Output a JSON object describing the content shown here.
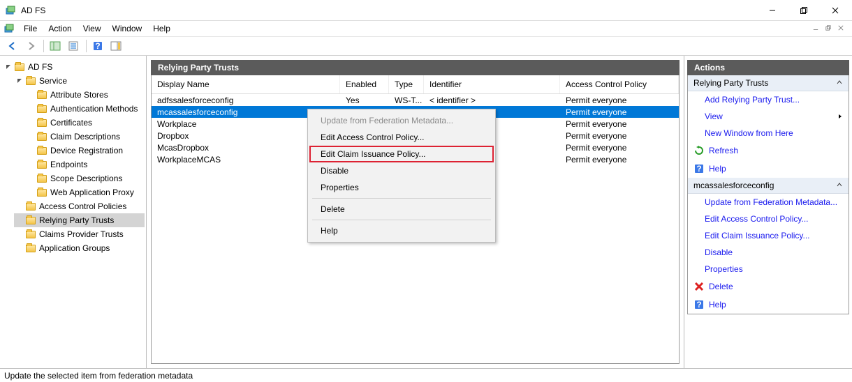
{
  "window": {
    "title": "AD FS"
  },
  "menubar": {
    "items": [
      "File",
      "Action",
      "View",
      "Window",
      "Help"
    ]
  },
  "tree": {
    "root": "AD FS",
    "service": {
      "label": "Service",
      "children": [
        "Attribute Stores",
        "Authentication Methods",
        "Certificates",
        "Claim Descriptions",
        "Device Registration",
        "Endpoints",
        "Scope Descriptions",
        "Web Application Proxy"
      ]
    },
    "siblings": [
      "Access Control Policies",
      "Relying Party Trusts",
      "Claims Provider Trusts",
      "Application Groups"
    ],
    "selected": "Relying Party Trusts"
  },
  "center": {
    "title": "Relying Party Trusts",
    "columns": [
      "Display Name",
      "Enabled",
      "Type",
      "Identifier",
      "Access Control Policy"
    ],
    "rows": [
      {
        "name": "adfssalesforceconfig",
        "enabled": "Yes",
        "type": "WS-T...",
        "identifier": "< identifier >",
        "acp": "Permit everyone",
        "sel": false
      },
      {
        "name": "mcassalesforceconfig",
        "enabled": "",
        "type": "",
        "identifier": "",
        "acp": "Permit everyone",
        "sel": true
      },
      {
        "name": "Workplace",
        "enabled": "",
        "type": "",
        "identifier": "",
        "acp": "Permit everyone",
        "sel": false
      },
      {
        "name": "Dropbox",
        "enabled": "",
        "type": "",
        "identifier": "",
        "acp": "Permit everyone",
        "sel": false
      },
      {
        "name": "McasDropbox",
        "enabled": "",
        "type": "",
        "identifier": "",
        "acp": "Permit everyone",
        "sel": false
      },
      {
        "name": "WorkplaceMCAS",
        "enabled": "",
        "type": "",
        "identifier": "",
        "acp": "Permit everyone",
        "sel": false
      }
    ]
  },
  "context": {
    "items": [
      {
        "label": "Update from Federation Metadata...",
        "state": "disabled"
      },
      {
        "label": "Edit Access Control Policy...",
        "state": ""
      },
      {
        "label": "Edit Claim Issuance Policy...",
        "state": "highlighted"
      },
      {
        "label": "Disable",
        "state": ""
      },
      {
        "label": "Properties",
        "state": ""
      },
      {
        "sep": true
      },
      {
        "label": "Delete",
        "state": ""
      },
      {
        "sep": true
      },
      {
        "label": "Help",
        "state": ""
      }
    ]
  },
  "actions": {
    "title": "Actions",
    "groups": [
      {
        "head": "Relying Party Trusts",
        "items": [
          {
            "label": "Add Relying Party Trust...",
            "icon": ""
          },
          {
            "label": "View",
            "icon": "",
            "arrow": true
          },
          {
            "label": "New Window from Here",
            "icon": ""
          },
          {
            "label": "Refresh",
            "icon": "refresh"
          },
          {
            "label": "Help",
            "icon": "help"
          }
        ]
      },
      {
        "head": "mcassalesforceconfig",
        "items": [
          {
            "label": "Update from Federation Metadata...",
            "icon": ""
          },
          {
            "label": "Edit Access Control Policy...",
            "icon": ""
          },
          {
            "label": "Edit Claim Issuance Policy...",
            "icon": ""
          },
          {
            "label": "Disable",
            "icon": ""
          },
          {
            "label": "Properties",
            "icon": ""
          },
          {
            "label": "Delete",
            "icon": "delete"
          },
          {
            "label": "Help",
            "icon": "help"
          }
        ]
      }
    ]
  },
  "status": "Update the selected item from federation metadata"
}
